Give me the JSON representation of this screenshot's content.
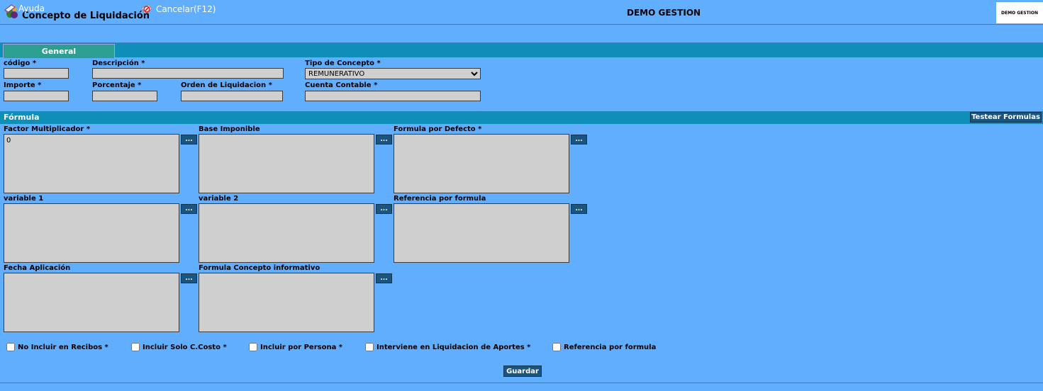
{
  "header": {
    "title": "Concepto de Liquidación",
    "company": "DEMO GESTION",
    "logo_text": "DEMO GESTION"
  },
  "toolbar": {
    "help_label": "Ayuda",
    "cancel_label": "Cancelar(F12)"
  },
  "tabs": [
    {
      "label": "General",
      "active": true
    }
  ],
  "form": {
    "codigo": {
      "label": "código *",
      "value": ""
    },
    "descripcion": {
      "label": "Descripción *",
      "value": ""
    },
    "tipo_concepto": {
      "label": "Tipo de Concepto *",
      "value": "REMUNERATIVO"
    },
    "importe": {
      "label": "Importe *",
      "value": ""
    },
    "porcentaje": {
      "label": "Porcentaje *",
      "value": ""
    },
    "orden": {
      "label": "Orden de Liquidacion *",
      "value": ""
    },
    "cuenta": {
      "label": "Cuenta Contable *",
      "value": ""
    }
  },
  "formula": {
    "section_title": "Fórmula",
    "test_button": "Testear Formulas",
    "picker_label": "...",
    "fields": {
      "factor": {
        "label": "Factor Multiplicador *",
        "value": "0"
      },
      "base": {
        "label": "Base Imponible",
        "value": ""
      },
      "defecto": {
        "label": "Formula por Defecto *",
        "value": ""
      },
      "var1": {
        "label": "variable 1",
        "value": ""
      },
      "var2": {
        "label": "variable 2",
        "value": ""
      },
      "referencia": {
        "label": "Referencia por formula",
        "value": ""
      },
      "fecha": {
        "label": "Fecha Aplicación",
        "value": ""
      },
      "informativo": {
        "label": "Formula Concepto informativo",
        "value": ""
      }
    }
  },
  "checkboxes": {
    "no_incluir": {
      "label": "No Incluir en Recibos *",
      "checked": false
    },
    "solo_ccosto": {
      "label": "Incluir Solo C.Costo *",
      "checked": false
    },
    "por_persona": {
      "label": "Incluir por Persona *",
      "checked": false
    },
    "aportes": {
      "label": "Interviene en Liquidacion de Aportes *",
      "checked": false
    },
    "referencia": {
      "label": "Referencia por formula",
      "checked": false
    }
  },
  "save_button": "Guardar",
  "colors": {
    "background": "#62aefe",
    "section_bar": "#0d8fb8",
    "tab_active": "#2d9f91",
    "button": "#1a5580",
    "field": "#cfcfcf"
  },
  "icons": {
    "app": "coffee-bean-icon",
    "help": "help-book-icon",
    "cancel": "cancel-icon"
  }
}
